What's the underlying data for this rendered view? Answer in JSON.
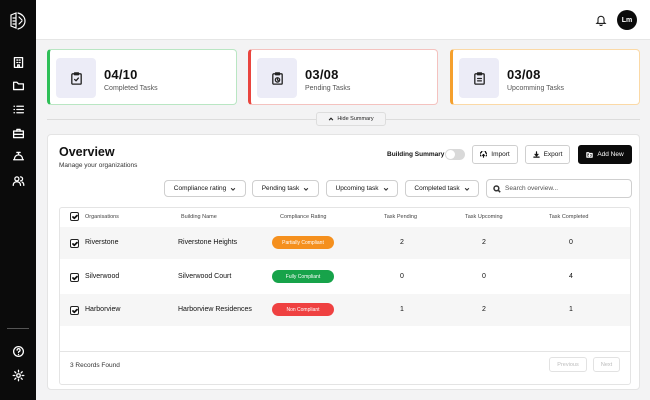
{
  "header": {
    "avatar_initials": "Lm"
  },
  "sidebar": {
    "items": [
      {
        "icon": "building-icon"
      },
      {
        "icon": "folder-icon"
      },
      {
        "icon": "list-icon"
      },
      {
        "icon": "briefcase-icon"
      },
      {
        "icon": "service-bell-icon"
      },
      {
        "icon": "users-icon"
      }
    ],
    "bottom": [
      {
        "icon": "help-icon"
      },
      {
        "icon": "settings-icon"
      }
    ]
  },
  "summary": {
    "cards": [
      {
        "value": "04/10",
        "label": "Completed Tasks",
        "accent": "#2fbf57"
      },
      {
        "value": "03/08",
        "label": "Pending Tasks",
        "accent": "#e9453e"
      },
      {
        "value": "03/08",
        "label": "Upcomming Tasks",
        "accent": "#f5a02d"
      }
    ],
    "hide_label": "Hide Summary"
  },
  "overview": {
    "title": "Overview",
    "subtitle": "Manage your organizations",
    "building_summary_label": "Building Summary",
    "import_label": "Import",
    "export_label": "Export",
    "add_label": "Add New",
    "filters": [
      "Compliance rating",
      "Pending task",
      "Upcoming task",
      "Completed task"
    ],
    "search_placeholder": "Search overview..."
  },
  "table": {
    "columns": [
      "Organisations",
      "Building Name",
      "Compliance Rating",
      "Task Pending",
      "Task Upcoming",
      "Task Completed"
    ],
    "rows": [
      {
        "organisation": "Riverstone",
        "building": "Riverstone Heights",
        "rating": "Partially Compliant",
        "rating_color": "#f5901e",
        "pending": "2",
        "upcoming": "2",
        "completed": "0"
      },
      {
        "organisation": "Silverwood",
        "building": "Silverwood Court",
        "rating": "Fully Compliant",
        "rating_color": "#17a34a",
        "pending": "0",
        "upcoming": "0",
        "completed": "4"
      },
      {
        "organisation": "Harborview",
        "building": "Harborview Residences",
        "rating": "Non Compliant",
        "rating_color": "#ef4141",
        "pending": "1",
        "upcoming": "2",
        "completed": "1"
      }
    ],
    "records_text": "3 Records Found",
    "prev_label": "Previous",
    "next_label": "Next"
  }
}
